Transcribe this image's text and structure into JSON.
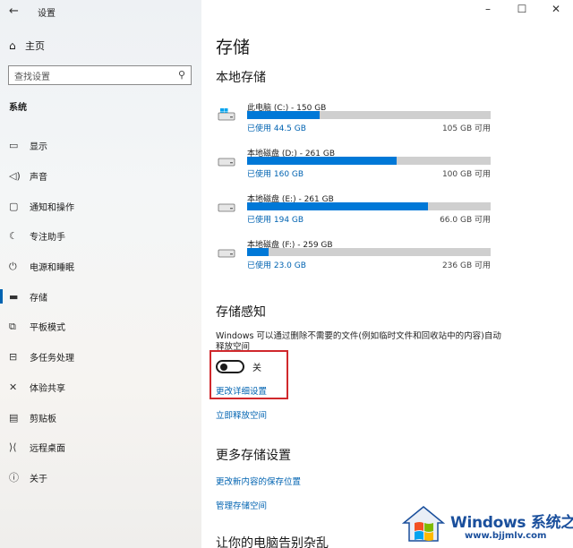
{
  "app": {
    "back_icon": "back-arrow-icon",
    "title": "设置"
  },
  "sidebar": {
    "home_label": "主页",
    "search_placeholder": "查找设置",
    "section_label": "系统",
    "items": [
      {
        "label": "显示",
        "icon": "monitor-icon"
      },
      {
        "label": "声音",
        "icon": "speaker-icon"
      },
      {
        "label": "通知和操作",
        "icon": "notification-icon"
      },
      {
        "label": "专注助手",
        "icon": "moon-icon"
      },
      {
        "label": "电源和睡眠",
        "icon": "power-icon"
      },
      {
        "label": "存储",
        "icon": "storage-icon",
        "active": true
      },
      {
        "label": "平板模式",
        "icon": "tablet-icon"
      },
      {
        "label": "多任务处理",
        "icon": "multitask-icon"
      },
      {
        "label": "体验共享",
        "icon": "share-icon"
      },
      {
        "label": "剪贴板",
        "icon": "clipboard-icon"
      },
      {
        "label": "远程桌面",
        "icon": "remote-icon"
      },
      {
        "label": "关于",
        "icon": "info-icon"
      }
    ]
  },
  "main": {
    "title": "存储",
    "local_storage_heading": "本地存储",
    "drives": [
      {
        "name": "此电脑 (C:) - 150 GB",
        "used": "已使用 44.5 GB",
        "free": "105 GB 可用",
        "fraction": 0.297,
        "icon": "windows-drive-icon"
      },
      {
        "name": "本地磁盘 (D:) - 261 GB",
        "used": "已使用 160 GB",
        "free": "100 GB 可用",
        "fraction": 0.613,
        "icon": "drive-icon"
      },
      {
        "name": "本地磁盘 (E:) - 261 GB",
        "used": "已使用 194 GB",
        "free": "66.0 GB 可用",
        "fraction": 0.743,
        "icon": "drive-icon"
      },
      {
        "name": "本地磁盘 (F:) - 259 GB",
        "used": "已使用 23.0 GB",
        "free": "236 GB 可用",
        "fraction": 0.089,
        "icon": "drive-icon"
      }
    ],
    "storage_sense_heading": "存储感知",
    "storage_sense_desc": "Windows 可以通过删除不需要的文件(例如临时文件和回收站中的内容)自动释放空间",
    "toggle_label": "关",
    "toggle_on": false,
    "change_settings_link": "更改详细设置",
    "free_up_link": "立即释放空间",
    "more_heading": "更多存储设置",
    "change_save_link": "更改新内容的保存位置",
    "manage_spaces_link": "管理存储空间",
    "bottom_heading": "让你的电脑告别杂乱",
    "accent_color": "#0078d7",
    "highlight_color": "#d0282c"
  },
  "window_controls": {
    "minimize": "–",
    "maximize": "☐",
    "close": "✕"
  },
  "watermark": {
    "brand": "Windows",
    "cn": "系统之家",
    "url": "www.bjjmlv.com"
  }
}
